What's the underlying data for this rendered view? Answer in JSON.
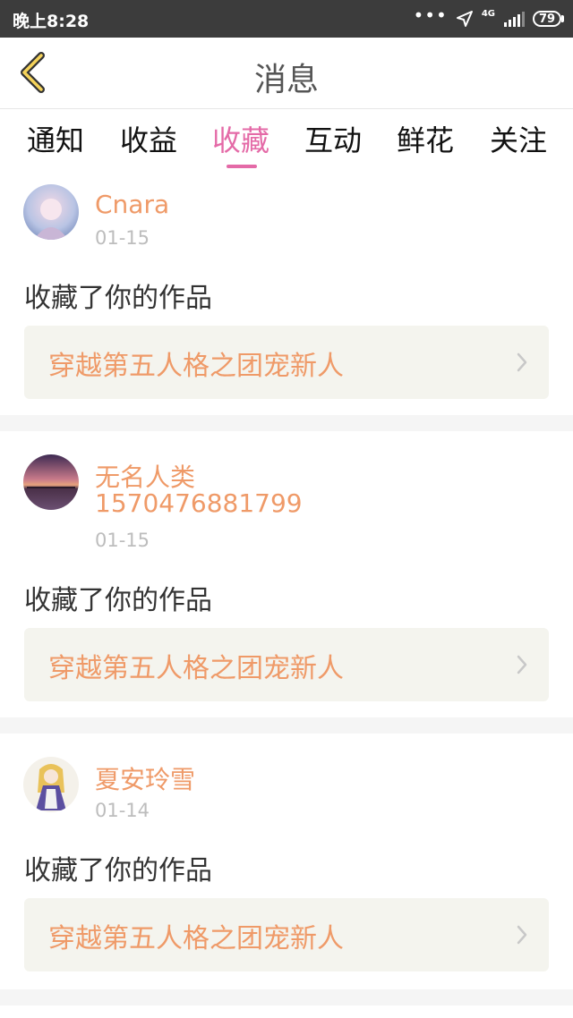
{
  "status_bar": {
    "time": "晚上8:28",
    "network": "4G",
    "battery": "79"
  },
  "header": {
    "title": "消息"
  },
  "tabs": [
    {
      "label": "通知",
      "active": false
    },
    {
      "label": "收益",
      "active": false
    },
    {
      "label": "收藏",
      "active": true
    },
    {
      "label": "互动",
      "active": false
    },
    {
      "label": "鲜花",
      "active": false
    },
    {
      "label": "关注",
      "active": false
    }
  ],
  "messages": [
    {
      "username": "Cnara",
      "date": "01-15",
      "action": "收藏了你的作品",
      "work_title": "穿越第五人格之团宠新人"
    },
    {
      "username": "无名人类\n1570476881799",
      "username_line1": "无名人类",
      "username_line2": "1570476881799",
      "date": "01-15",
      "action": "收藏了你的作品",
      "work_title": "穿越第五人格之团宠新人"
    },
    {
      "username": "夏安玲雪",
      "date": "01-14",
      "action": "收藏了你的作品",
      "work_title": "穿越第五人格之团宠新人"
    }
  ],
  "colors": {
    "accent": "#e46aa7",
    "username": "#ef9a68",
    "status_bar": "#3c3c3c"
  }
}
